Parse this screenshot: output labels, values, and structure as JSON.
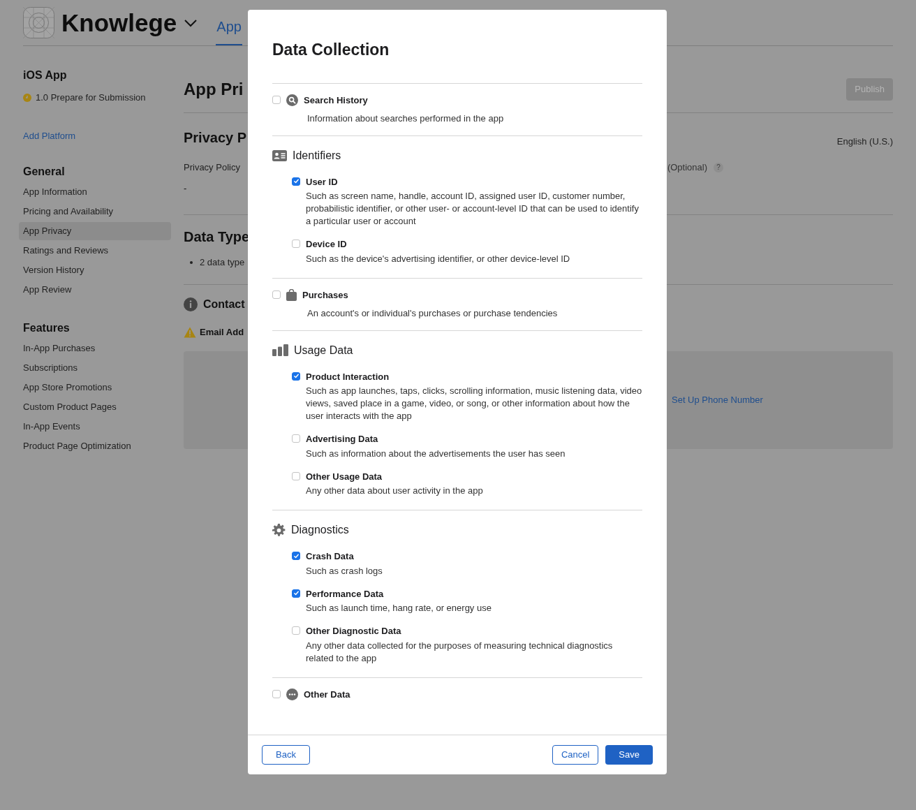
{
  "header": {
    "app_name": "Knowlege",
    "tab": "App"
  },
  "sidebar": {
    "platform": "iOS App",
    "version_status": "1.0 Prepare for Submission",
    "add_platform": "Add Platform",
    "groups": [
      {
        "title": "General",
        "items": [
          {
            "label": "App Information",
            "selected": false
          },
          {
            "label": "Pricing and Availability",
            "selected": false
          },
          {
            "label": "App Privacy",
            "selected": true
          },
          {
            "label": "Ratings and Reviews",
            "selected": false
          },
          {
            "label": "Version History",
            "selected": false
          },
          {
            "label": "App Review",
            "selected": false
          }
        ]
      },
      {
        "title": "Features",
        "items": [
          {
            "label": "In-App Purchases",
            "selected": false
          },
          {
            "label": "Subscriptions",
            "selected": false
          },
          {
            "label": "App Store Promotions",
            "selected": false
          },
          {
            "label": "Custom Product Pages",
            "selected": false
          },
          {
            "label": "In-App Events",
            "selected": false
          },
          {
            "label": "Product Page Optimization",
            "selected": false
          }
        ]
      }
    ]
  },
  "main": {
    "title": "App Pri",
    "publish": "Publish",
    "privacy_title": "Privacy P",
    "language": "English (U.S.)",
    "policy_label": "Privacy Policy",
    "optional": "(Optional)",
    "help": "?",
    "policy_value": "-",
    "data_types_title": "Data Type",
    "data_types_bullet": "2 data type",
    "contact_title": "Contact",
    "email_label": "Email Add",
    "phone_link": "Set Up Phone Number"
  },
  "dialog": {
    "title": "Data Collection",
    "sections": [
      {
        "kind": "single",
        "title": "Search History",
        "checked": false,
        "description": "Information about searches performed in the app"
      },
      {
        "kind": "group",
        "title": "Identifiers",
        "items": [
          {
            "title": "User ID",
            "checked": true,
            "description": "Such as screen name, handle, account ID, assigned user ID, customer number, probabilistic identifier, or other user- or account-level ID that can be used to identify a particular user or account"
          },
          {
            "title": "Device ID",
            "checked": false,
            "description": "Such as the device's advertising identifier, or other device-level ID"
          }
        ]
      },
      {
        "kind": "single",
        "title": "Purchases",
        "checked": false,
        "description": "An account's or individual's purchases or purchase tendencies"
      },
      {
        "kind": "group",
        "title": "Usage Data",
        "items": [
          {
            "title": "Product Interaction",
            "checked": true,
            "description": "Such as app launches, taps, clicks, scrolling information, music listening data, video views, saved place in a game, video, or song, or other information about how the user interacts with the app"
          },
          {
            "title": "Advertising Data",
            "checked": false,
            "description": "Such as information about the advertisements the user has seen"
          },
          {
            "title": "Other Usage Data",
            "checked": false,
            "description": "Any other data about user activity in the app"
          }
        ]
      },
      {
        "kind": "group",
        "title": "Diagnostics",
        "items": [
          {
            "title": "Crash Data",
            "checked": true,
            "description": "Such as crash logs"
          },
          {
            "title": "Performance Data",
            "checked": true,
            "description": "Such as launch time, hang rate, or energy use"
          },
          {
            "title": "Other Diagnostic Data",
            "checked": false,
            "description": "Any other data collected for the purposes of measuring technical diagnostics related to the app"
          }
        ]
      },
      {
        "kind": "single",
        "title": "Other Data",
        "checked": false
      }
    ],
    "buttons": {
      "back": "Back",
      "cancel": "Cancel",
      "save": "Save"
    }
  }
}
